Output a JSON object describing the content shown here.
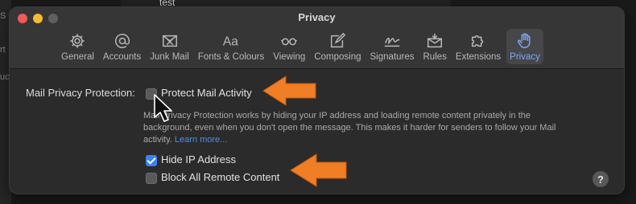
{
  "background": {
    "title_fragment": "test",
    "side_fragments": [
      "S",
      "rt",
      "uc"
    ]
  },
  "window": {
    "title": "Privacy",
    "toolbar": [
      {
        "label": "General",
        "icon": "gear-icon"
      },
      {
        "label": "Accounts",
        "icon": "at-icon"
      },
      {
        "label": "Junk Mail",
        "icon": "junk-tray-icon"
      },
      {
        "label": "Fonts & Colours",
        "icon": "font-aa-icon"
      },
      {
        "label": "Viewing",
        "icon": "glasses-icon"
      },
      {
        "label": "Composing",
        "icon": "compose-icon"
      },
      {
        "label": "Signatures",
        "icon": "signature-icon"
      },
      {
        "label": "Rules",
        "icon": "rules-envelope-icon"
      },
      {
        "label": "Extensions",
        "icon": "puzzle-icon"
      },
      {
        "label": "Privacy",
        "icon": "hand-icon",
        "active": true
      }
    ]
  },
  "privacy": {
    "section_label": "Mail Privacy Protection:",
    "protect_mail_activity": {
      "label": "Protect Mail Activity",
      "checked": false
    },
    "description": "Mail Privacy Protection works by hiding your IP address and loading remote content privately in the background, even when you don't open the message. This makes it harder for senders to follow your Mail activity.",
    "learn_more": "Learn more...",
    "hide_ip": {
      "label": "Hide IP Address",
      "checked": true
    },
    "block_remote": {
      "label": "Block All Remote Content",
      "checked": false
    },
    "help": "?"
  },
  "colors": {
    "accent": "#3a82f7",
    "annotation_arrow": "#f07e25",
    "active_tab_text": "#7fa8f0"
  }
}
